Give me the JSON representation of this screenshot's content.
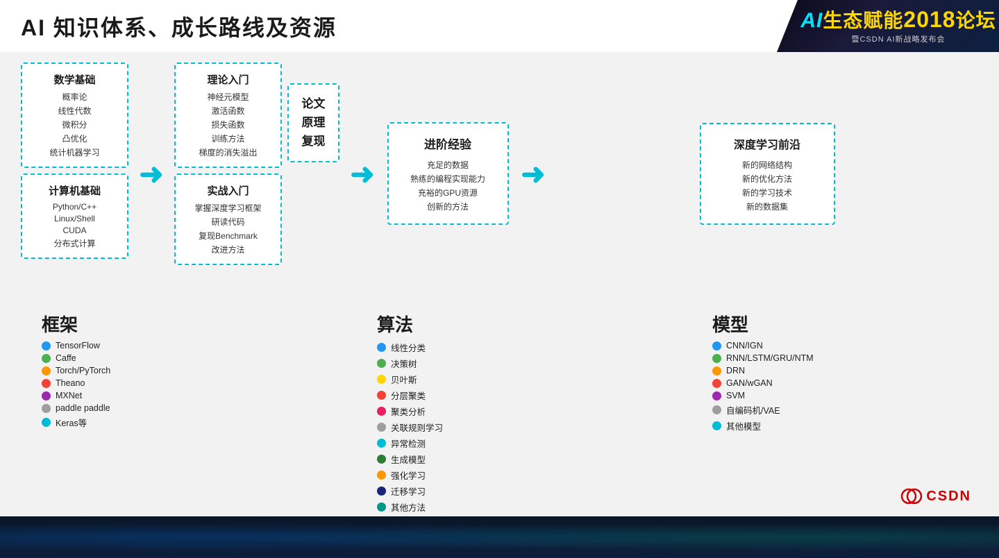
{
  "header": {
    "title": "AI 知识体系、成长路线及资源"
  },
  "logo": {
    "line1_ai": "AI",
    "line1_eco": "生态赋能",
    "line1_year": "2018",
    "line1_forum": "论坛",
    "line2": "暨CSDN AI新战略发布会"
  },
  "flow": {
    "box1": {
      "section1_title": "数学基础",
      "section1_items": [
        "概率论",
        "线性代数",
        "微积分",
        "凸优化",
        "统计机器学习"
      ],
      "section2_title": "计算机基础",
      "section2_items": [
        "Python/C++",
        "Linux/Shell",
        "CUDA",
        "分布式计算"
      ]
    },
    "arrow1": "→",
    "box2": {
      "section1_title": "理论入门",
      "section1_items": [
        "神经元模型",
        "激活函数",
        "损失函数",
        "训练方法",
        "梯度的消失溢出"
      ],
      "section2_title": "实战入门",
      "section2_items": [
        "掌握深度学习框架",
        "研读代码",
        "复现Benchmark",
        "改进方法"
      ]
    },
    "arrow2": "→",
    "box3": {
      "lines": [
        "论文",
        "原理",
        "复现"
      ]
    },
    "arrow3": "→",
    "box4": {
      "title": "进阶经验",
      "items": [
        "充足的数据",
        "熟练的编程实现能力",
        "充裕的GPU资源",
        "创新的方法"
      ]
    },
    "arrow4": "→",
    "box5": {
      "title": "深度学习前沿",
      "items": [
        "新的网络结构",
        "新的优化方法",
        "新的学习技术",
        "新的数据集"
      ]
    }
  },
  "legends": {
    "framework": {
      "title": "框架",
      "items": [
        {
          "color": "#2196F3",
          "label": "TensorFlow"
        },
        {
          "color": "#4CAF50",
          "label": "Caffe"
        },
        {
          "color": "#FF9800",
          "label": "Torch/PyTorch"
        },
        {
          "color": "#F44336",
          "label": "Theano"
        },
        {
          "color": "#9C27B0",
          "label": "MXNet"
        },
        {
          "color": "#9E9E9E",
          "label": "paddle paddle"
        },
        {
          "color": "#00BCD4",
          "label": "Keras等"
        }
      ]
    },
    "algorithm": {
      "title": "算法",
      "items": [
        {
          "color": "#2196F3",
          "label": "线性分类"
        },
        {
          "color": "#4CAF50",
          "label": "决策树"
        },
        {
          "color": "#FFEB3B",
          "label": "贝叶斯"
        },
        {
          "color": "#F44336",
          "label": "分层聚类"
        },
        {
          "color": "#E91E63",
          "label": "聚类分析"
        },
        {
          "color": "#9E9E9E",
          "label": "关联规则学习"
        },
        {
          "color": "#00BCD4",
          "label": "异常检测"
        },
        {
          "color": "#4CAF50",
          "label": "生成模型"
        },
        {
          "color": "#FF9800",
          "label": "强化学习"
        },
        {
          "color": "#1A237E",
          "label": "迁移学习"
        },
        {
          "color": "#009688",
          "label": "其他方法"
        }
      ]
    },
    "model": {
      "title": "模型",
      "items": [
        {
          "color": "#2196F3",
          "label": "CNN/IGN"
        },
        {
          "color": "#4CAF50",
          "label": "RNN/LSTM/GRU/NTM"
        },
        {
          "color": "#FF9800",
          "label": "DRN"
        },
        {
          "color": "#F44336",
          "label": "GAN/wGAN"
        },
        {
          "color": "#9C27B0",
          "label": "SVM"
        },
        {
          "color": "#9E9E9E",
          "label": "自编码机/VAE"
        },
        {
          "color": "#00BCD4",
          "label": "其他模型"
        }
      ]
    }
  },
  "csdn": {
    "text": "CSDN"
  }
}
